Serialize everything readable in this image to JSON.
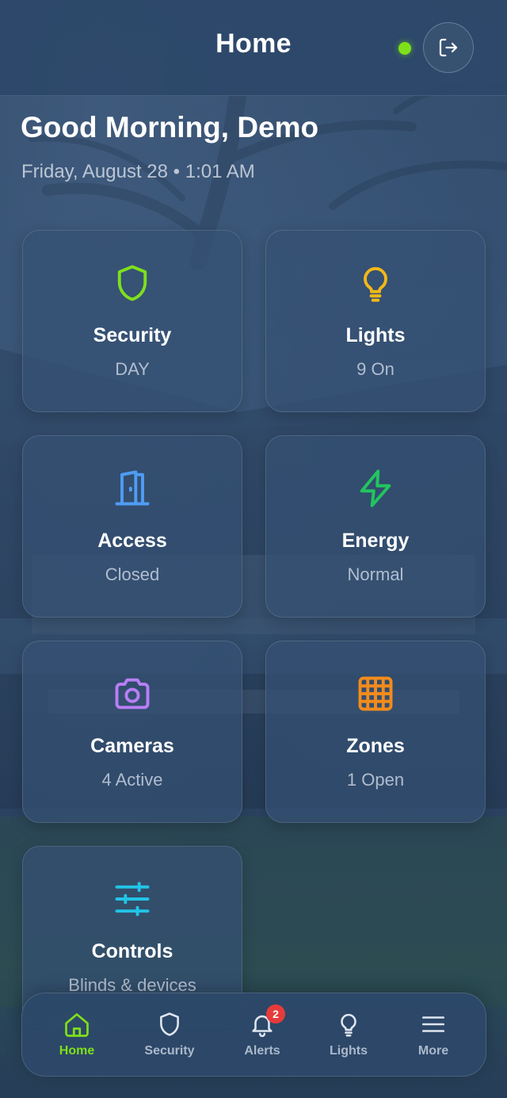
{
  "header": {
    "title": "Home",
    "status": "online",
    "logout_icon": "logout-icon"
  },
  "greeting": "Good Morning, Demo",
  "date_line": "Friday, August 28 • 1:01 AM",
  "tiles": [
    {
      "name": "Security",
      "status": "DAY",
      "icon": "shield-icon",
      "color": "#7fe01a"
    },
    {
      "name": "Lights",
      "status": "9 On",
      "icon": "lightbulb-icon",
      "color": "#f2b817"
    },
    {
      "name": "Access",
      "status": "Closed",
      "icon": "door-icon",
      "color": "#4f9cf5"
    },
    {
      "name": "Energy",
      "status": "Normal",
      "icon": "lightning-icon",
      "color": "#22c55e"
    },
    {
      "name": "Cameras",
      "status": "4 Active",
      "icon": "camera-icon",
      "color": "#b87ef5"
    },
    {
      "name": "Zones",
      "status": "1 Open",
      "icon": "grid-icon",
      "color": "#f28b1c"
    },
    {
      "name": "Controls",
      "status": "Blinds & devices",
      "icon": "sliders-icon",
      "color": "#22c4e6"
    }
  ],
  "nav": {
    "items": [
      {
        "label": "Home",
        "icon": "home-icon",
        "active": true
      },
      {
        "label": "Security",
        "icon": "shield-icon",
        "active": false
      },
      {
        "label": "Alerts",
        "icon": "bell-icon",
        "active": false,
        "badge": "2"
      },
      {
        "label": "Lights",
        "icon": "lightbulb-icon",
        "active": false
      },
      {
        "label": "More",
        "icon": "menu-icon",
        "active": false
      }
    ]
  },
  "colors": {
    "accent": "#7fe01a",
    "badge": "#e63b3b"
  }
}
